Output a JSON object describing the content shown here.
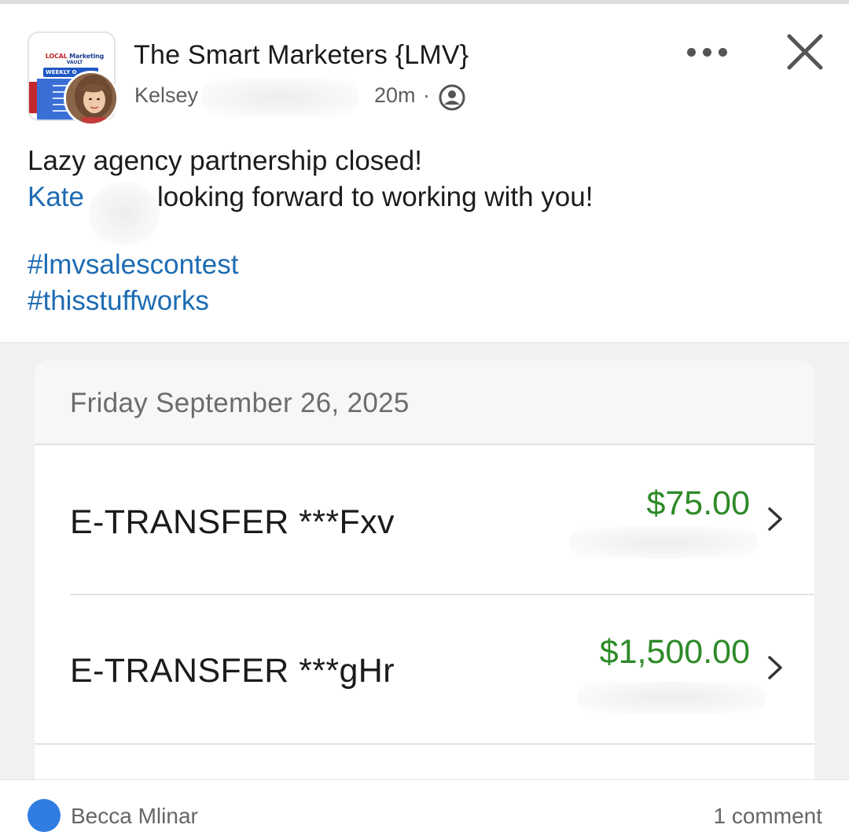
{
  "post": {
    "group_name": "The Smart Marketers {LMV}",
    "author": "Kelsey",
    "time": "20m",
    "separator": "·",
    "audience_icon": "members-icon",
    "menu_icon": "more-icon",
    "close_icon": "close-icon",
    "group_avatar": {
      "brand_local": "LOCAL",
      "brand_marketing": "Marketing",
      "brand_vault": "VAULT",
      "banner": "WEEKLY O"
    },
    "body_line1": "Lazy agency partnership closed!",
    "mention": "Kate",
    "body_line2_rest": "looking forward to working with you!",
    "hashtags": [
      "#lmvsalescontest",
      "#thisstuffworks"
    ]
  },
  "attachment": {
    "date": "Friday September 26, 2025",
    "transactions": [
      {
        "label": "E-TRANSFER ***Fxv",
        "amount": "$75.00"
      },
      {
        "label": "E-TRANSFER ***gHr",
        "amount": "$1,500.00"
      }
    ],
    "amount_color": "#2e8a28"
  },
  "footer": {
    "reactor": "Becca Mlinar",
    "comment_count": "1 comment"
  },
  "colors": {
    "link": "#1d6bb3",
    "text": "#1c1c1c",
    "muted": "#5e5e5e",
    "media_bg": "#f1f1f1"
  }
}
